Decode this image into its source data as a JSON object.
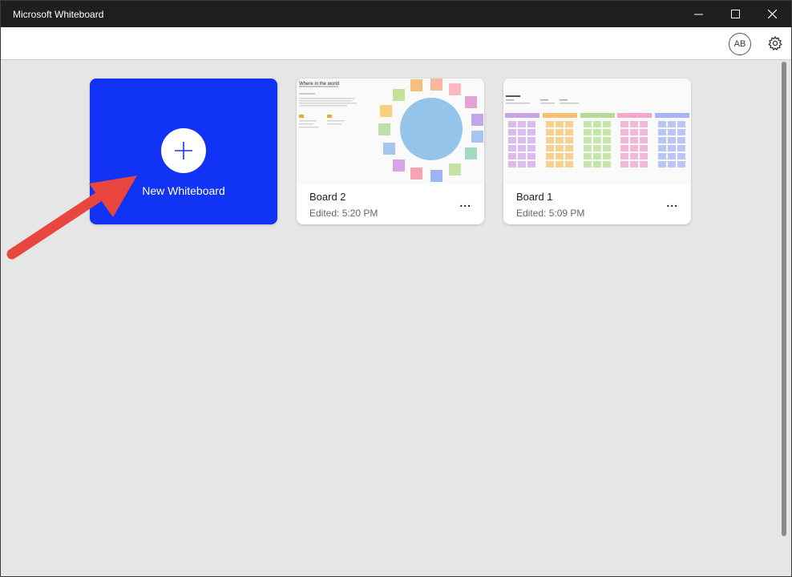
{
  "window": {
    "title": "Microsoft Whiteboard"
  },
  "toolbar": {
    "avatar_initials": "AB",
    "settings_icon": "gear-icon"
  },
  "cards": {
    "new": {
      "label": "New Whiteboard",
      "icon": "plus-icon"
    },
    "boards": [
      {
        "name": "Board 2",
        "edited": "Edited: 5:20 PM",
        "more": "..."
      },
      {
        "name": "Board 1",
        "edited": "Edited: 5:09 PM",
        "more": "..."
      }
    ]
  },
  "thumbnails": {
    "board2": {
      "heading": "Where in the world"
    },
    "board1": {
      "heading": ""
    }
  },
  "colors": {
    "accent": "#1033f5",
    "annotation_arrow": "#e8463f",
    "titlebar": "#1f1f1f",
    "background": "#e6e6e6"
  }
}
